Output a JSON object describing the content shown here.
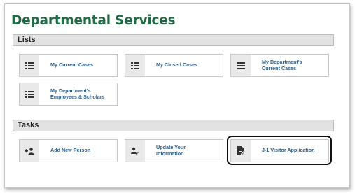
{
  "page": {
    "title": "Departmental Services"
  },
  "lists": {
    "heading": "Lists",
    "items": [
      {
        "label": "My Current Cases",
        "icon": "list-icon"
      },
      {
        "label": "My Closed Cases",
        "icon": "list-icon"
      },
      {
        "label": "My Department's Current Cases",
        "icon": "list-icon"
      },
      {
        "label": "My Department's Employees & Scholars",
        "icon": "list-icon"
      }
    ]
  },
  "tasks": {
    "heading": "Tasks",
    "items": [
      {
        "label": "Add New Person",
        "icon": "add-person-icon"
      },
      {
        "label": "Update Your Information",
        "icon": "edit-person-icon"
      },
      {
        "label": "J-1 Visitor Application",
        "icon": "document-edit-icon"
      }
    ]
  },
  "colors": {
    "title": "#1f6b44",
    "link": "#2c5f8a",
    "section_bar": "#e2e2e2"
  }
}
